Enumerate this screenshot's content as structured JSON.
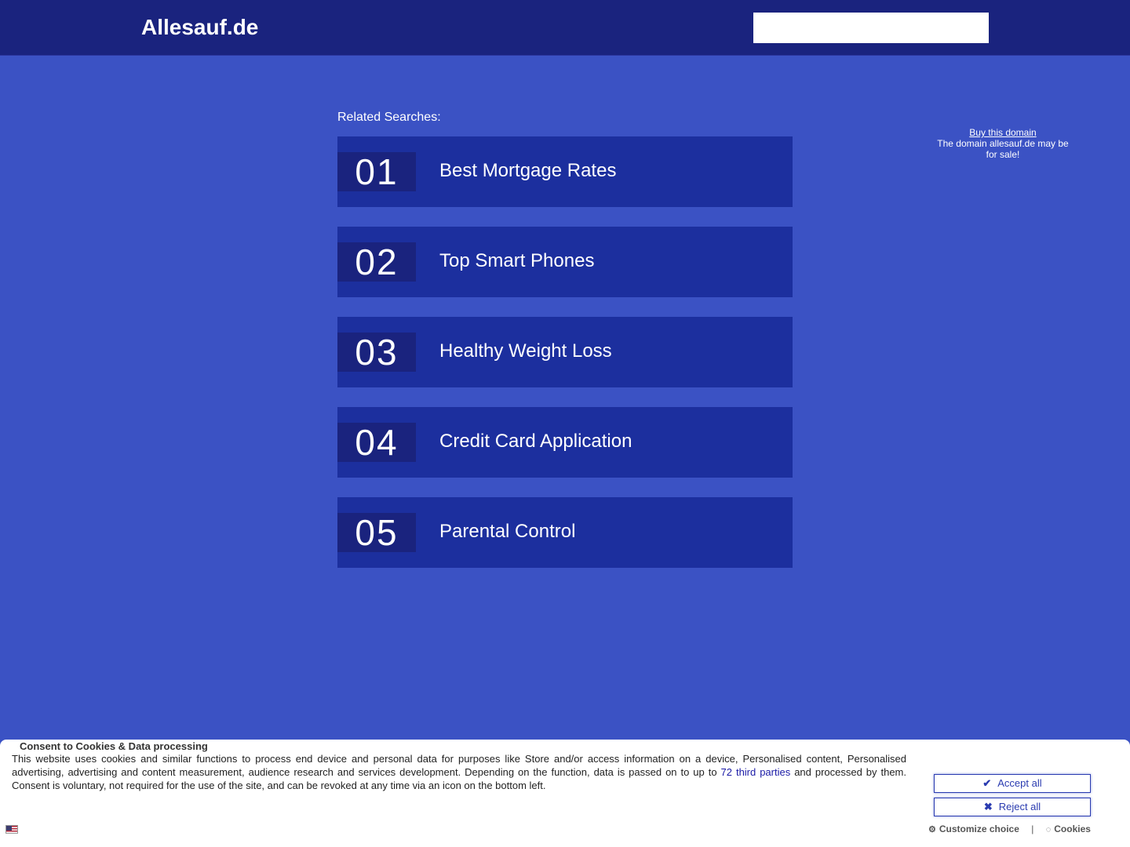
{
  "header": {
    "logo": "Allesauf.de",
    "search_placeholder": "",
    "search_value": ""
  },
  "related": {
    "heading": "Related Searches:",
    "items": [
      {
        "num": "01",
        "label": "Best Mortgage Rates"
      },
      {
        "num": "02",
        "label": "Top Smart Phones"
      },
      {
        "num": "03",
        "label": "Healthy Weight Loss"
      },
      {
        "num": "04",
        "label": "Credit Card Application"
      },
      {
        "num": "05",
        "label": "Parental Control"
      }
    ]
  },
  "sale": {
    "link": "Buy this domain",
    "text": "The domain allesauf.de may be for sale!"
  },
  "consent": {
    "title": "Consent to Cookies & Data processing",
    "text_before": "This website uses cookies and similar functions to process end device and personal data for purposes like Store and/or access information on a device, Personalised content, Personalised advertising, advertising and content measurement, audience research and services development. Depending on the function, data is passed on to up to ",
    "parties_link": "72 third parties",
    "text_after": " and processed by them. Consent is voluntary, not required for the use of the site, and can be revoked at any time via an icon on the bottom left.",
    "accept_label": "Accept all",
    "reject_label": "Reject all",
    "customize_label": "Customize choice",
    "cookies_label": "Cookies",
    "separator": "|"
  },
  "colors": {
    "page_bg": "#3b52c4",
    "header_bg": "#1a237e",
    "result_bg": "#1c2f9e",
    "number_bg": "#1a237e",
    "button_accent": "#2a3bb0"
  },
  "icons": {
    "accept": "check-icon",
    "reject": "x-icon",
    "customize": "gear-icon",
    "cookies": "cookie-icon",
    "language": "us-flag-icon"
  }
}
